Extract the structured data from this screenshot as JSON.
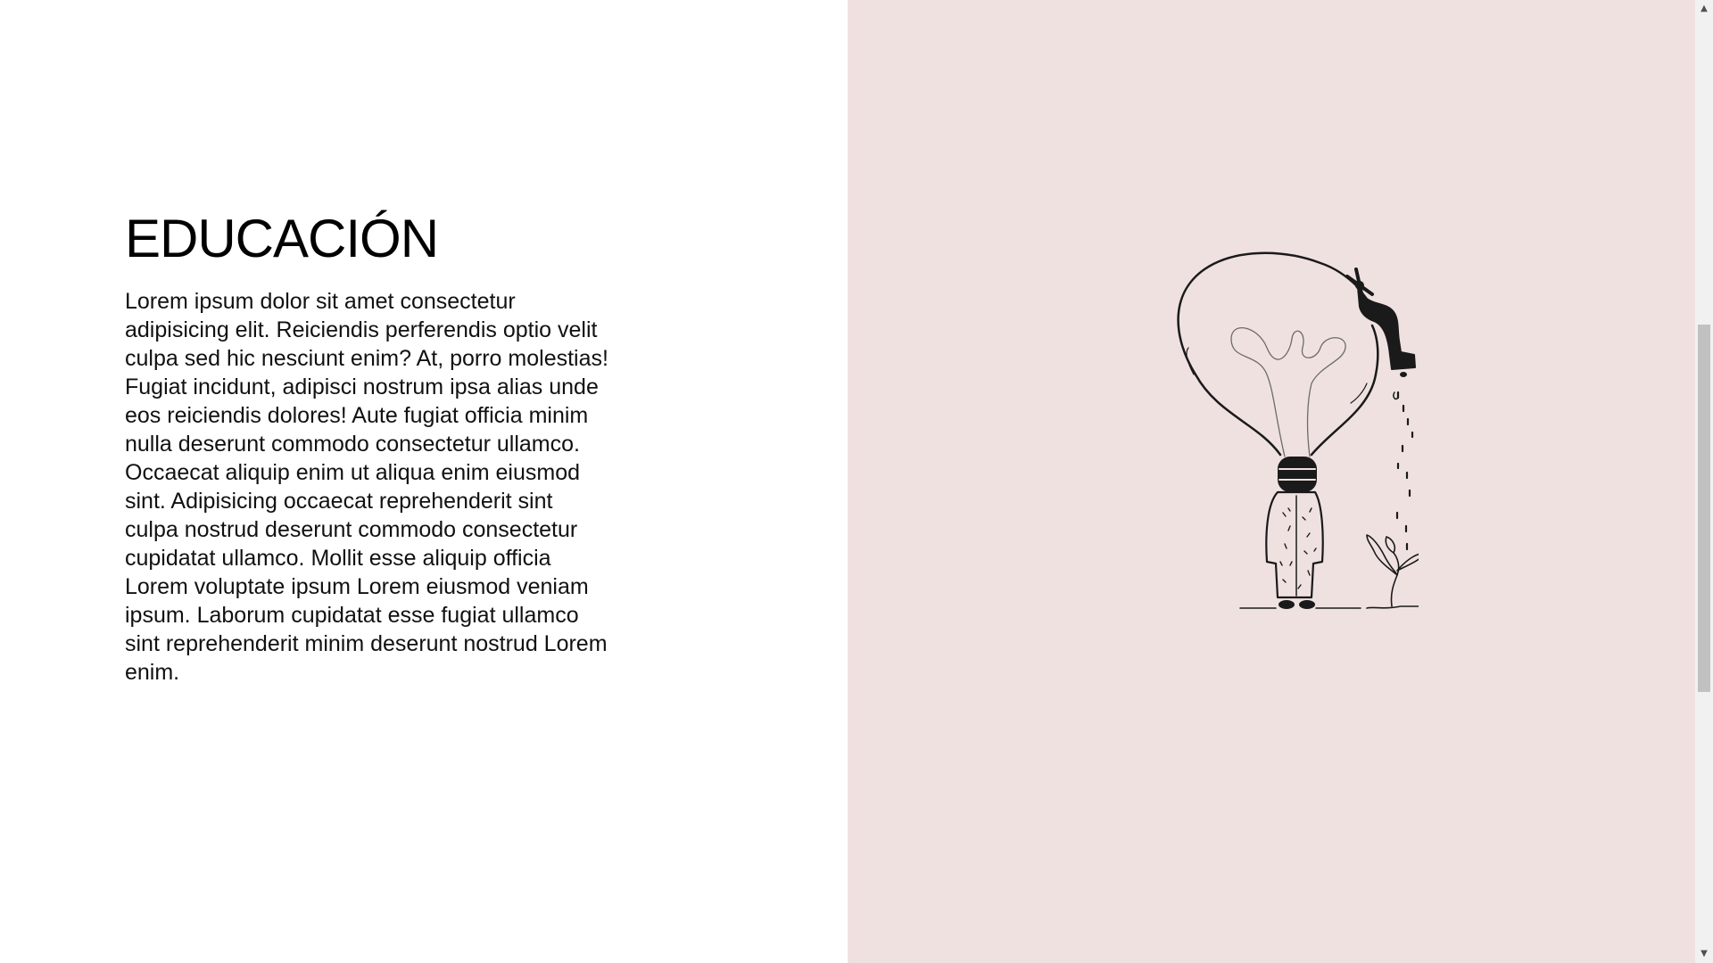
{
  "section": {
    "heading": "EDUCACIÓN",
    "body": "Lorem ipsum dolor sit amet consectetur adipisicing elit. Reiciendis perferendis optio velit culpa sed hic nesciunt enim? At, porro molestias! Fugiat incidunt, adipisci nostrum ipsa alias unde eos reiciendis dolores! Aute fugiat officia minim nulla deserunt commodo consectetur ullamco. Occaecat aliquip enim ut aliqua enim eiusmod sint. Adipisicing occaecat reprehenderit sint culpa nostrud deserunt commodo consectetur cupidatat ullamco. Mollit esse aliquip officia Lorem voluptate ipsum Lorem eiusmod veniam ipsum. Laborum cupidatat esse fugiat ullamco sint reprehenderit minim deserunt nostrud Lorem enim."
  },
  "colors": {
    "right_panel_bg": "#f0e1e1",
    "ink": "#1a1a1a"
  },
  "illustration": {
    "icon": "lightbulb-faucet-person-plant-illustration"
  },
  "scrollbar": {
    "up_icon": "▲",
    "down_icon": "▼"
  }
}
